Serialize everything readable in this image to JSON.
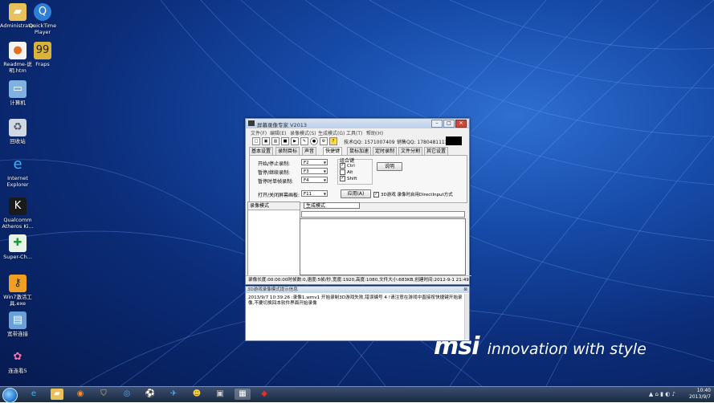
{
  "desktop": {
    "icons": [
      {
        "label": "Administrator",
        "icon": "folder-icon"
      },
      {
        "label": "QuickTime Player",
        "icon": "quicktime-icon"
      },
      {
        "label": "Readme-说明.htm",
        "icon": "html-file-icon"
      },
      {
        "label": "Fraps",
        "icon": "fraps-icon"
      },
      {
        "label": "计算机",
        "icon": "computer-icon"
      },
      {
        "label": "回收站",
        "icon": "recycle-bin-icon"
      },
      {
        "label": "Internet Explorer",
        "icon": "ie-icon"
      },
      {
        "label": "Qualcomm Atheros Ki...",
        "icon": "qualcomm-icon"
      },
      {
        "label": "Super-Ch...",
        "icon": "super-charger-icon"
      },
      {
        "label": "Win7激活工具.exe",
        "icon": "activator-icon"
      },
      {
        "label": "宽带连接",
        "icon": "broadband-icon"
      },
      {
        "label": "连连看5",
        "icon": "game-icon"
      }
    ],
    "brand_logo": "msi",
    "brand_tagline": "innovation with style"
  },
  "window": {
    "title": "屏幕录像专家 V2013",
    "menu": [
      "文件(F)",
      "编辑(E)",
      "录像模式(S)",
      "生成模式(G)",
      "工具(T)",
      "帮助(H)"
    ],
    "toolbar_support": "技术QQ: 1571007409",
    "toolbar_sales": "销售QQ: 1780481113",
    "tabs": [
      "基本设置",
      "录制目标",
      "声音",
      "快捷键",
      "鼠标加速",
      "定时录制",
      "文件分割",
      "其它设置"
    ],
    "active_tab": "快捷键",
    "hotkeys": [
      {
        "label": "开始/停止录制:",
        "value": "F2"
      },
      {
        "label": "暂停/继续录制:",
        "value": "F3"
      },
      {
        "label": "暂停时单帧录制:",
        "value": "F4"
      }
    ],
    "combo_title": "组合键",
    "combo_keys": [
      {
        "label": "Ctrl",
        "checked": true
      },
      {
        "label": "Alt",
        "checked": false
      },
      {
        "label": "Shift",
        "checked": true
      }
    ],
    "help_button": "说明",
    "panel_label": "打开/关闭屏幕画板:",
    "panel_key": "F11",
    "apply_button": "应用(A)",
    "directinput_label": "3D游戏 录像时启用DirectInput方式",
    "directinput_checked": true,
    "record_mode_header": "录像模式",
    "generate_mode": "生成模式",
    "status": "录像长度:00:00:00时帧数:0,速度:5帧/秒,宽度:1920,高度:1080,文件大小:683KB,创建时间:2012-9-1 21:49"
  },
  "log": {
    "title": "3D游戏录像模式提示信息",
    "text": "2013/9/7 10:39:26 :录像1.wmv1 开始录制3D游戏失败,错误编号 4 !请注意在游戏中直接按快捷键开始录像,不要切换回本软件界面开始录像"
  },
  "taskbar": {
    "time": "10:40",
    "date": "2013/9/7"
  },
  "colors": {
    "desktop_bg": "#0b2c78",
    "window_title": "#bccfe8",
    "taskbar": "#1c2a40"
  }
}
